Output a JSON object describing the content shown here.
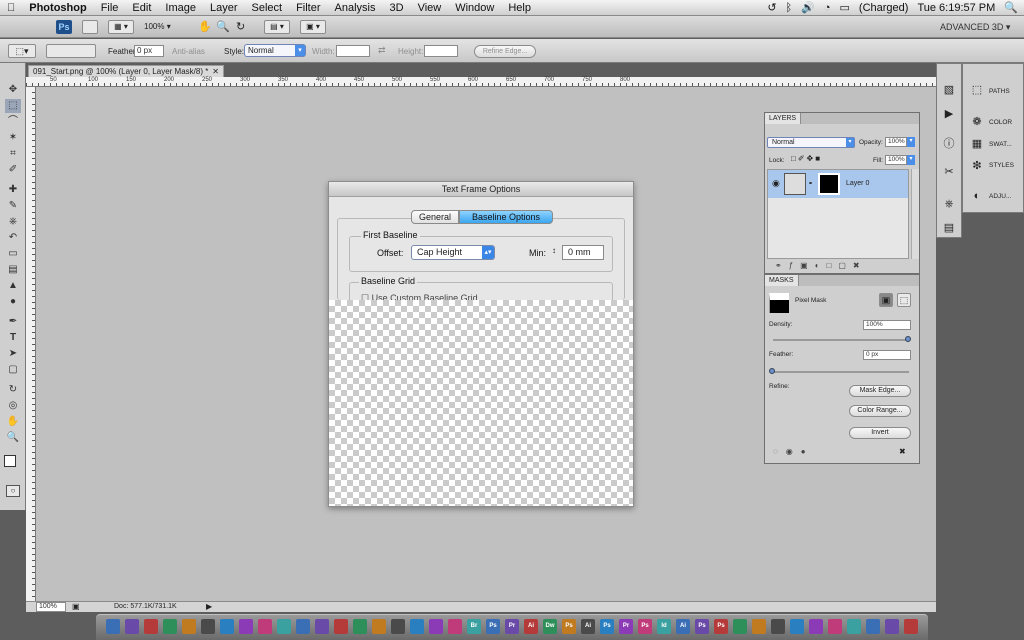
{
  "menubar": {
    "apple": "",
    "app": "Photoshop",
    "items": [
      "File",
      "Edit",
      "Image",
      "Layer",
      "Select",
      "Filter",
      "Analysis",
      "3D",
      "View",
      "Window",
      "Help"
    ],
    "battery": "(Charged)",
    "clock": "Tue 6:19:57 PM"
  },
  "appbar": {
    "ps": "Ps",
    "zoom": "100%",
    "workspace": "ADVANCED 3D"
  },
  "options": {
    "feather_label": "Feather:",
    "feather_value": "0 px",
    "antialias": "Anti-alias",
    "style_label": "Style:",
    "style_value": "Normal",
    "width_label": "Width:",
    "height_label": "Height:",
    "refine": "Refine Edge..."
  },
  "document": {
    "tab": "091_Start.png @ 100% (Layer 0, Layer Mask/8) *",
    "ruler_labels": [
      "50",
      "100",
      "150",
      "200",
      "250",
      "300",
      "350",
      "400",
      "450",
      "500",
      "550",
      "600",
      "650",
      "700",
      "750",
      "800"
    ],
    "zoom": "100%",
    "doc_info": "Doc: 577.1K/731.1K"
  },
  "dialog": {
    "title": "Text Frame Options",
    "tab_general": "General",
    "tab_baseline": "Baseline Options",
    "first_baseline": "First Baseline",
    "offset_label": "Offset:",
    "offset_value": "Cap Height",
    "min_label": "Min:",
    "min_value": "0 mm",
    "baseline_grid": "Baseline Grid",
    "custom_grid": "Use Custom Baseline Grid"
  },
  "dock_right": {
    "paths": "PATHS",
    "color": "COLOR",
    "swatches": "SWAT...",
    "styles": "STYLES",
    "adjust": "ADJU..."
  },
  "layers": {
    "tab": "LAYERS",
    "blend": "Normal",
    "opacity_label": "Opacity:",
    "opacity": "100%",
    "lock_label": "Lock:",
    "fill_label": "Fill:",
    "fill": "100%",
    "layer_name": "Layer 0"
  },
  "masks": {
    "tab": "MASKS",
    "pixel_mask": "Pixel Mask",
    "density_label": "Density:",
    "density": "100%",
    "feather_label": "Feather:",
    "feather": "0 px",
    "refine_label": "Refine:",
    "mask_edge": "Mask Edge...",
    "color_range": "Color Range...",
    "invert": "Invert",
    "density_level": 1.0,
    "feather_level": 0.0
  },
  "dock_apps": [
    "",
    "",
    "",
    "",
    "",
    "",
    "",
    "",
    "",
    "",
    "",
    "",
    "",
    "",
    "",
    "",
    "",
    "",
    "",
    "Br",
    "Ps",
    "Pr",
    "Ai",
    "Dw",
    "Ps",
    "Ai",
    "Ps",
    "Pr",
    "Ps",
    "Id",
    "Ai",
    "Ps",
    "Ps",
    "",
    "",
    "",
    "",
    "",
    "",
    "",
    "",
    "",
    ""
  ]
}
